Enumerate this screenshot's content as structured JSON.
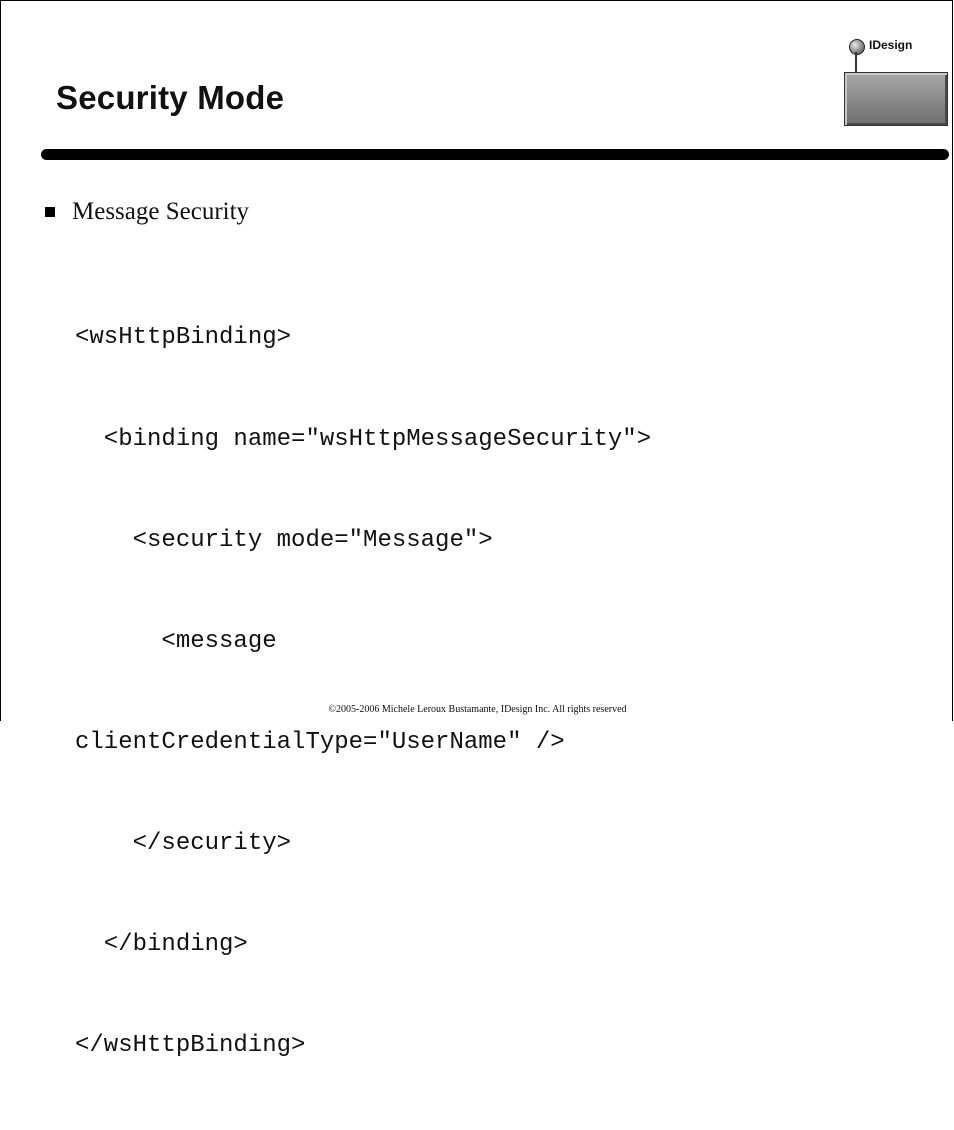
{
  "slide": {
    "title": "Security Mode",
    "logo_text": "IDesign",
    "bullet": "Message Security",
    "code_lines": [
      "<wsHttpBinding>",
      "  <binding name=\"wsHttpMessageSecurity\">",
      "    <security mode=\"Message\">",
      "      <message",
      "clientCredentialType=\"UserName\" />",
      "    </security>",
      "  </binding>",
      "</wsHttpBinding>"
    ],
    "footer": "©2005-2006 Michele Leroux Bustamante, IDesign Inc. All rights reserved"
  }
}
